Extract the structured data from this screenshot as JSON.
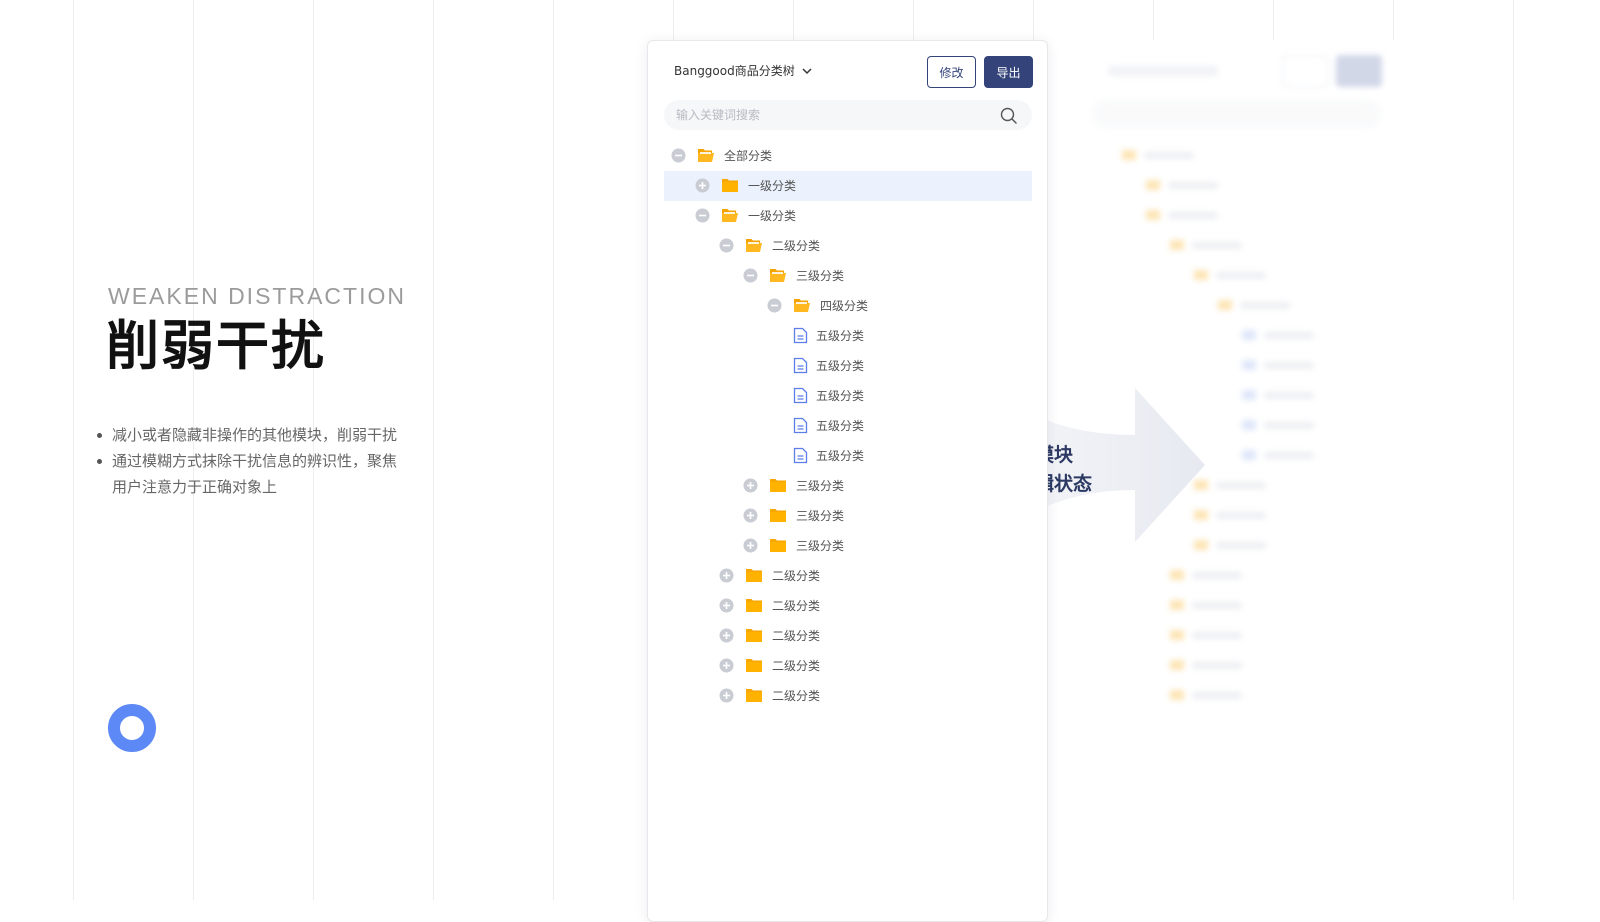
{
  "left": {
    "eyebrow": "WEAKEN DISTRACTION",
    "headline": "削弱干扰",
    "bullets": [
      "减小或者隐藏非操作的其他模块，削弱干扰",
      "通过模糊方式抹除干扰信息的辨识性，聚焦用户注意力于正确对象上"
    ]
  },
  "panel": {
    "selector_label": "Banggood商品分类树",
    "edit_label": "修改",
    "export_label": "导出",
    "search_placeholder": "输入关键词搜索"
  },
  "tree": [
    {
      "label": "全部分类",
      "level": 0,
      "toggle": "minus",
      "icon": "folder-open-icon",
      "highlight": false
    },
    {
      "label": "一级分类",
      "level": 1,
      "toggle": "plus",
      "icon": "folder-icon",
      "highlight": true
    },
    {
      "label": "一级分类",
      "level": 1,
      "toggle": "minus",
      "icon": "folder-open-icon",
      "highlight": false
    },
    {
      "label": "二级分类",
      "level": 2,
      "toggle": "minus",
      "icon": "folder-open-icon",
      "highlight": false
    },
    {
      "label": "三级分类",
      "level": 3,
      "toggle": "minus",
      "icon": "folder-open-icon",
      "highlight": false
    },
    {
      "label": "四级分类",
      "level": 4,
      "toggle": "minus",
      "icon": "folder-open-icon",
      "highlight": false
    },
    {
      "label": "五级分类",
      "level": 5,
      "toggle": "none",
      "icon": "document-icon",
      "highlight": false
    },
    {
      "label": "五级分类",
      "level": 5,
      "toggle": "none",
      "icon": "document-icon",
      "highlight": false
    },
    {
      "label": "五级分类",
      "level": 5,
      "toggle": "none",
      "icon": "document-icon",
      "highlight": false
    },
    {
      "label": "五级分类",
      "level": 5,
      "toggle": "none",
      "icon": "document-icon",
      "highlight": false
    },
    {
      "label": "五级分类",
      "level": 5,
      "toggle": "none",
      "icon": "document-icon",
      "highlight": false
    },
    {
      "label": "三级分类",
      "level": 3,
      "toggle": "plus",
      "icon": "folder-icon",
      "highlight": false
    },
    {
      "label": "三级分类",
      "level": 3,
      "toggle": "plus",
      "icon": "folder-icon",
      "highlight": false
    },
    {
      "label": "三级分类",
      "level": 3,
      "toggle": "plus",
      "icon": "folder-icon",
      "highlight": false
    },
    {
      "label": "二级分类",
      "level": 2,
      "toggle": "plus",
      "icon": "folder-icon",
      "highlight": false
    },
    {
      "label": "二级分类",
      "level": 2,
      "toggle": "plus",
      "icon": "folder-icon",
      "highlight": false
    },
    {
      "label": "二级分类",
      "level": 2,
      "toggle": "plus",
      "icon": "folder-icon",
      "highlight": false
    },
    {
      "label": "二级分类",
      "level": 2,
      "toggle": "plus",
      "icon": "folder-icon",
      "highlight": false
    },
    {
      "label": "二级分类",
      "level": 2,
      "toggle": "plus",
      "icon": "folder-icon",
      "highlight": false
    }
  ],
  "callout": {
    "line1": "其他模块",
    "line2": "进入编辑状态"
  },
  "colors": {
    "accent": "#34447a",
    "folder": "#f7a700",
    "highlight_row": "#ebf1fd",
    "document": "#5b7ee8",
    "ring": "#5d89f6"
  }
}
